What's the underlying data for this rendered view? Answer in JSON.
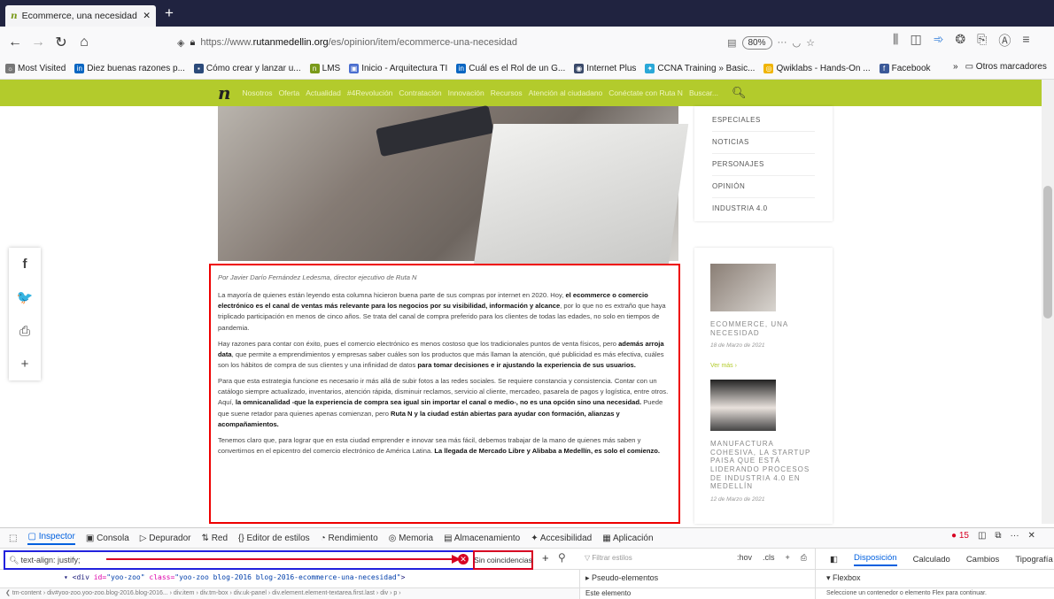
{
  "browser": {
    "tab_title": "Ecommerce, una necesidad - R",
    "tab_close": "✕",
    "new_tab": "+",
    "url_prefix": "https://www.",
    "url_host": "rutanmedellin.org",
    "url_path": "/es/opinion/item/ecommerce-una-necesidad",
    "zoom": "80%",
    "more": "···",
    "bookmarks": [
      {
        "label": "Most Visited",
        "color": "#777",
        "glyph": "☼"
      },
      {
        "label": "Diez buenas razones p...",
        "color": "#0a66c2",
        "glyph": "in"
      },
      {
        "label": "Cómo crear y lanzar u...",
        "color": "#2b4a7a",
        "glyph": "▪"
      },
      {
        "label": "LMS",
        "color": "#7a9a1a",
        "glyph": "n"
      },
      {
        "label": "Inicio - Arquitectura TI",
        "color": "#4a6ecf",
        "glyph": "▣"
      },
      {
        "label": "Cuál es el Rol de un G...",
        "color": "#0a66c2",
        "glyph": "in"
      },
      {
        "label": "Internet Plus",
        "color": "#3a4a6a",
        "glyph": "◉"
      },
      {
        "label": "CCNA Training » Basic...",
        "color": "#2aa8d8",
        "glyph": "✦"
      },
      {
        "label": "Qwiklabs - Hands-On ...",
        "color": "#f0b400",
        "glyph": "◎"
      },
      {
        "label": "Facebook",
        "color": "#3b5998",
        "glyph": "f"
      }
    ],
    "bookmarks_overflow": "»",
    "other_bookmarks": "Otros marcadores"
  },
  "site": {
    "logo": "n",
    "nav": [
      "Nosotros",
      "Oferta",
      "Actualidad",
      "#4Revolución",
      "Contratación",
      "Innovación",
      "Recursos",
      "Atención al ciudadano",
      "Conéctate con Ruta N",
      "Buscar..."
    ],
    "menu": [
      "ESPECIALES",
      "NOTICIAS",
      "PERSONAJES",
      "OPINIÓN",
      "INDUSTRIA 4.0"
    ],
    "cards": [
      {
        "title": "ECOMMERCE, UNA NECESIDAD",
        "date": "18 de Marzo de 2021",
        "more": "Ver más ›"
      },
      {
        "title": "MANUFACTURA COHESIVA, LA STARTUP PAISA QUE ESTÁ LIDERANDO PROCESOS DE INDUSTRIA 4.0 EN MEDELLÍN",
        "date": "12 de Marzo de 2021"
      }
    ],
    "social": [
      "f",
      "🐦",
      "⎙",
      "+"
    ]
  },
  "article": {
    "byline": "Por Javier Darío Fernández Ledesma, director ejecutivo de Ruta N",
    "p1a": "La mayoría de quienes están leyendo esta columna hicieron buena parte de sus compras por internet en 2020. Hoy, ",
    "p1b": "el ecommerce o comercio electrónico es el canal de ventas más relevante para los negocios por su visibilidad, información y alcance",
    "p1c": ", por lo que no es extraño que haya triplicado participación en menos de cinco años. Se trata del canal de compra preferido para los clientes de todas las edades, no solo en tiempos de pandemia.",
    "p2a": "Hay razones para contar con éxito, pues el comercio electrónico es menos costoso que los tradicionales puntos de venta físicos, pero ",
    "p2b": "además arroja data",
    "p2c": ", que permite a emprendimientos y empresas saber cuáles son los productos que más llaman la atención, qué publicidad es más efectiva, cuáles son los hábitos de compra de sus clientes y una infinidad de datos ",
    "p2d": "para tomar decisiones e ir ajustando la experiencia de sus usuarios.",
    "p3a": "Para que esta estrategia funcione es necesario ir más allá de subir fotos a las redes sociales. Se requiere constancia y consistencia. Contar con un catálogo siempre actualizado, inventarios, atención rápida, disminuir reclamos, servicio al cliente, mercadeo, pasarela de pagos y logística, entre otros. Aquí, ",
    "p3b": "la omnicanalidad -que la experiencia de compra sea igual sin importar el canal o medio-, no es una opción sino una necesidad.",
    "p3c": " Puede que suene retador para quienes apenas comienzan, pero ",
    "p3d": "Ruta N y la ciudad están abiertas para ayudar con formación, alianzas y acompañamientos.",
    "p4a": "Tenemos claro que, para lograr que en esta ciudad emprender e innovar sea más fácil, debemos trabajar de la mano de quienes más saben y convertirnos en el epicentro del comercio electrónico de América Latina. ",
    "p4b": "La llegada de Mercado Libre y Alibaba a Medellín, es solo el comienzo."
  },
  "devtools": {
    "tabs": [
      "Inspector",
      "Consola",
      "Depurador",
      "Red",
      "Editor de estilos",
      "Rendimiento",
      "Memoria",
      "Almacenamiento",
      "Accesibilidad",
      "Aplicación"
    ],
    "tab_icons": [
      "▢",
      "▣",
      "▷",
      "⇅",
      "{}",
      "◔",
      "◎",
      "▤",
      "✦",
      "▦"
    ],
    "error_count": "15",
    "search_value": "text-align: justify;",
    "no_matches": "Sin coincidencias",
    "filter_styles": "Filtrar estilos",
    "hov": ":hov",
    "cls": ".cls",
    "layout_tabs": [
      "Disposición",
      "Calculado",
      "Cambios",
      "Tipografía"
    ],
    "markup_tag": "<div",
    "markup_attr1": "id=",
    "markup_val1": "\"yoo-zoo\"",
    "markup_attr2": "class=",
    "markup_val2": "\"yoo-zoo blog-2016 blog-2016-ecommerce-una-necesidad\"",
    "markup_end": ">",
    "pseudo": "Pseudo-elementos",
    "flexbox": "Flexbox",
    "breadcrumbs": "tm-content  ›  div#yoo-zoo.yoo-zoo.blog-2016.blog-2016...  ›  div.item  ›  div.tm-box  ›  div.uk-panel  ›  div.element.element-textarea.first.last  ›  div  ›  p  ›",
    "este": "Este elemento",
    "flex_hint": "Seleccione un contenedor o elemento Flex para continuar."
  }
}
